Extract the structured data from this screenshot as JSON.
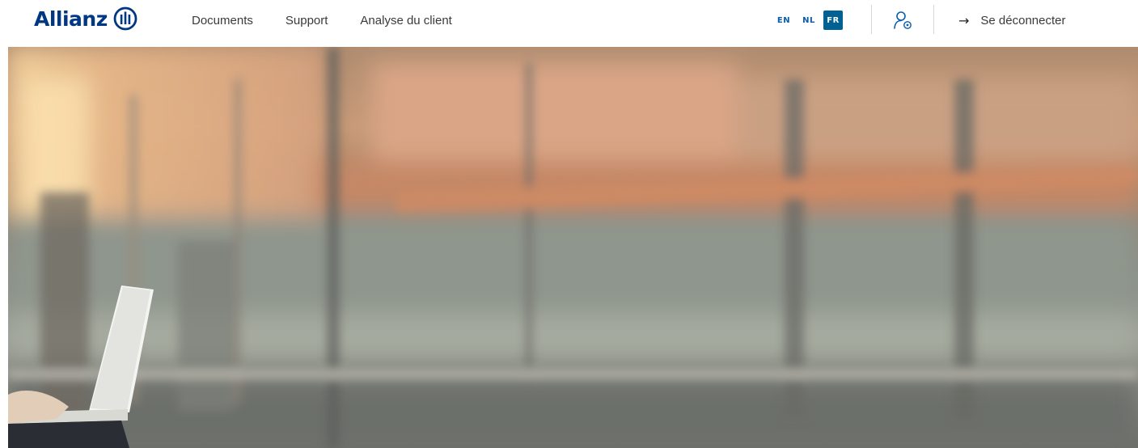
{
  "header": {
    "brand": "Allianz",
    "nav": [
      "Documents",
      "Support",
      "Analyse du client"
    ],
    "languages": [
      "EN",
      "NL",
      "FR"
    ],
    "active_language": "FR",
    "logout_label": "Se déconnecter"
  },
  "colors": {
    "brand_blue": "#003781",
    "active_lang_bg": "#006192",
    "lang_text": "#0a5cac"
  },
  "icons": {
    "logo_mark": "allianz-eagle-circle-icon",
    "user": "user-settings-icon",
    "logout": "arrow-right-icon"
  }
}
